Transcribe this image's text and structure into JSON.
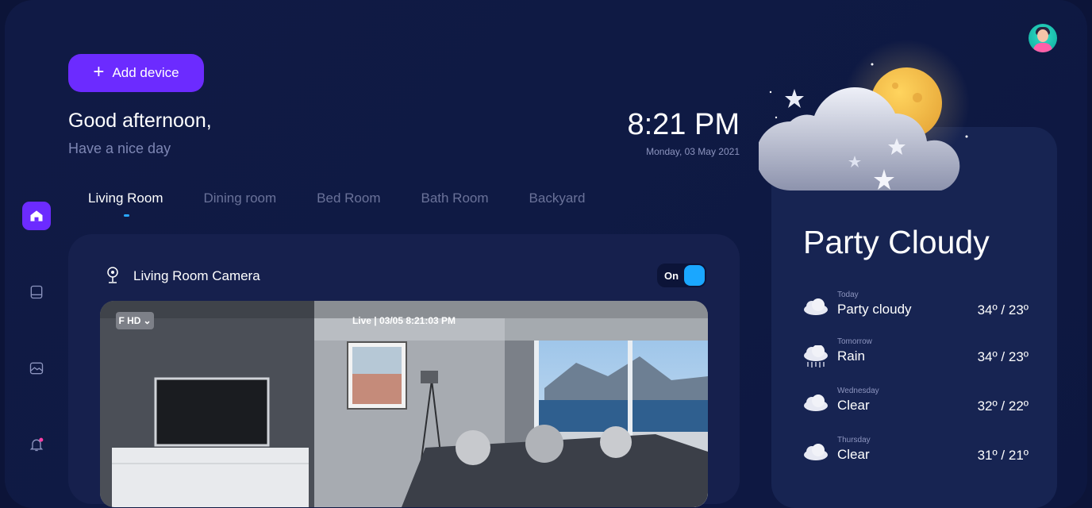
{
  "header": {
    "add_device_label": "Add device"
  },
  "greeting": {
    "title": "Good afternoon,",
    "subtitle": "Have a nice day"
  },
  "clock": {
    "time": "8:21 PM",
    "date": "Monday, 03 May 2021"
  },
  "tabs": [
    {
      "label": "Living Room",
      "active": true
    },
    {
      "label": "Dining room"
    },
    {
      "label": "Bed Room"
    },
    {
      "label": "Bath Room"
    },
    {
      "label": "Backyard"
    }
  ],
  "camera": {
    "title": "Living Room Camera",
    "toggle_label": "On",
    "quality": "F HD",
    "live_label": "Live | 03/05 8:21:03 PM"
  },
  "weather": {
    "title": "Party Cloudy",
    "forecast": [
      {
        "day": "Today",
        "condition": "Party cloudy",
        "temp": "34º / 23º",
        "icon": "partly-cloudy-icon"
      },
      {
        "day": "Tomorrow",
        "condition": "Rain",
        "temp": "34º / 23º",
        "icon": "rain-icon"
      },
      {
        "day": "Wednesday",
        "condition": "Clear",
        "temp": "32º / 22º",
        "icon": "cloud-icon"
      },
      {
        "day": "Thursday",
        "condition": "Clear",
        "temp": "31º / 21º",
        "icon": "cloud-icon"
      }
    ]
  },
  "sidebar": {
    "items": [
      {
        "icon": "home-icon",
        "active": true
      },
      {
        "icon": "tablet-icon"
      },
      {
        "icon": "image-icon"
      },
      {
        "icon": "bell-icon",
        "badge": true
      }
    ]
  },
  "colors": {
    "accent": "#6c2bff",
    "toggle_on": "#1aa7ff",
    "background": "#0f1a44",
    "card": "#16204d"
  }
}
